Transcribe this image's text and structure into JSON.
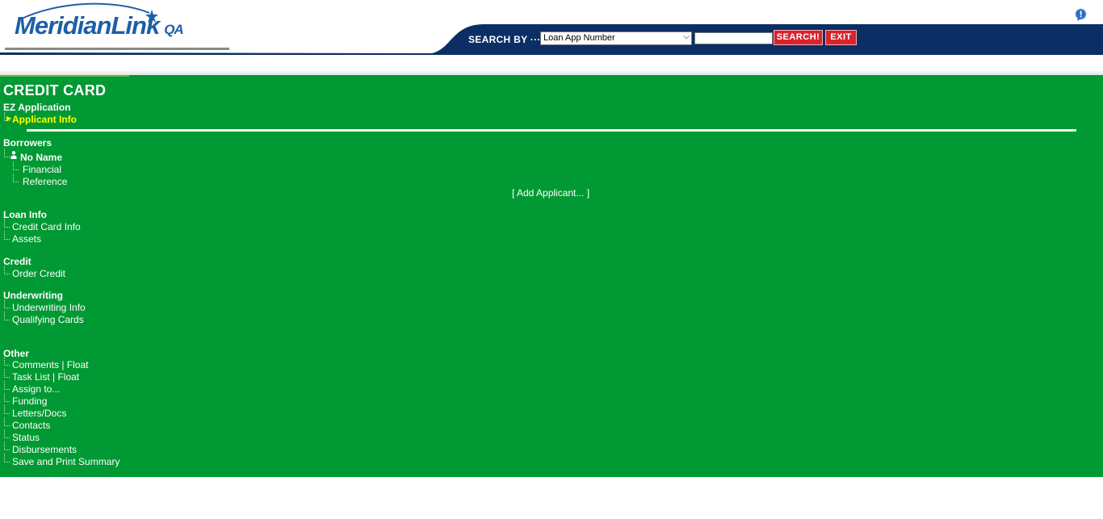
{
  "header": {
    "logo_text": "MeridianLink",
    "logo_env": "QA",
    "search_by_label": "SEARCH BY ···>",
    "search_select_value": "Loan App Number",
    "search_input_value": "",
    "search_button": "SEARCH!",
    "exit_button": "EXIT",
    "colors": {
      "navy": "#0b2f64",
      "brand_blue": "#1e5ea8",
      "red": "#d9232d"
    }
  },
  "panel": {
    "title": "CREDIT CARD",
    "background": "#009933",
    "ez": {
      "label": "EZ Application",
      "items": [
        "Applicant Info"
      ]
    },
    "borrowers": {
      "label": "Borrowers",
      "name": "No Name",
      "items": [
        "Financial",
        "Reference"
      ]
    },
    "add_applicant": "[ Add Applicant... ]",
    "loan_info": {
      "label": "Loan Info",
      "items": [
        "Credit Card Info",
        "Assets"
      ]
    },
    "credit": {
      "label": "Credit",
      "items": [
        "Order Credit"
      ]
    },
    "underwriting": {
      "label": "Underwriting",
      "items": [
        "Underwriting Info",
        "Qualifying Cards"
      ]
    },
    "other": {
      "label": "Other",
      "items": [
        "Comments | Float",
        "Task List | Float",
        "Assign to...",
        "Funding",
        "Letters/Docs",
        "Contacts",
        "Status",
        "Disbursements",
        "Save and Print Summary"
      ]
    }
  }
}
